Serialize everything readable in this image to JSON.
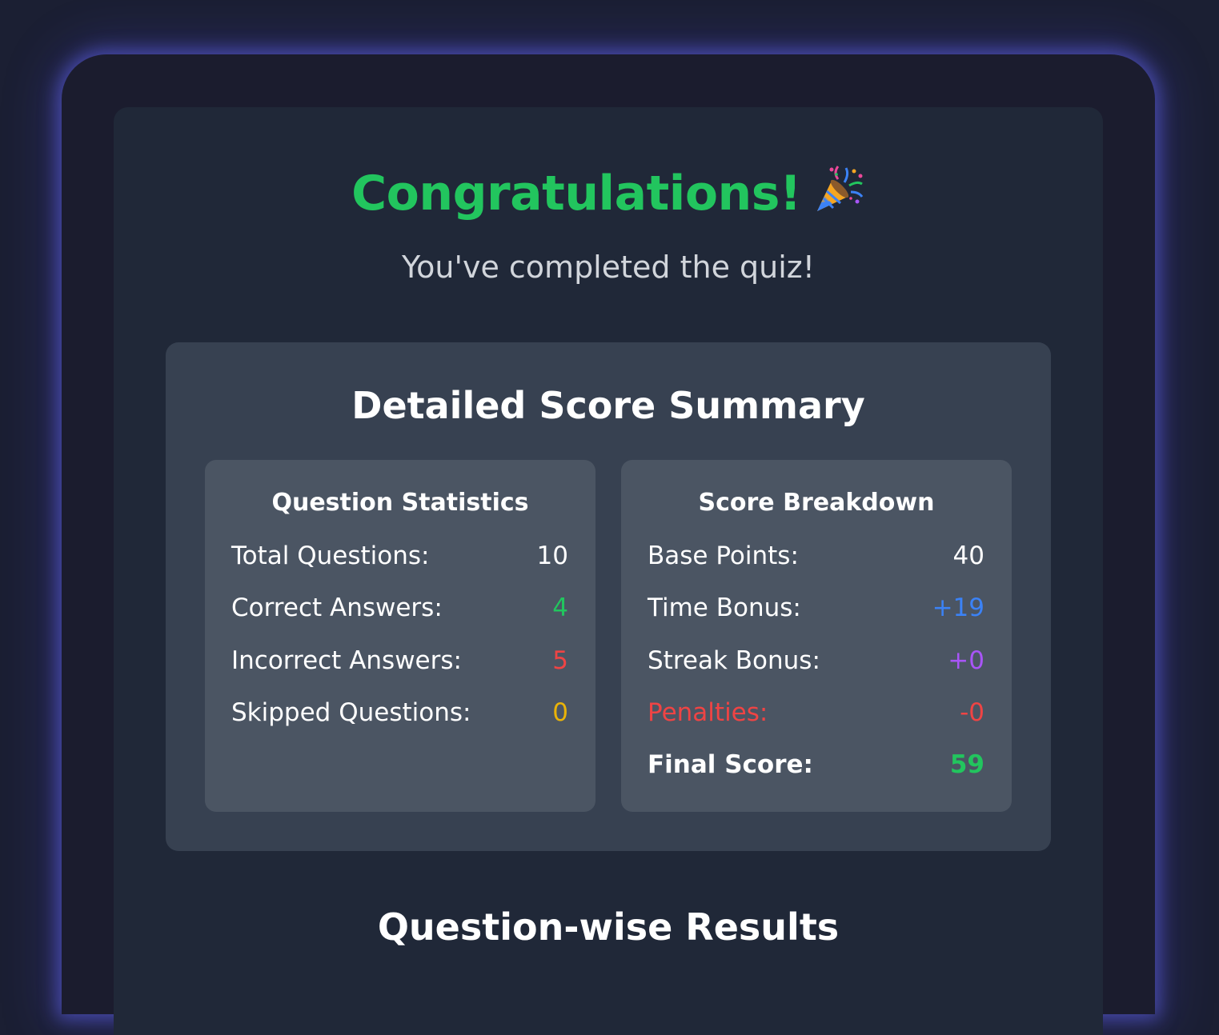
{
  "header": {
    "title": "Congratulations!",
    "title_icon": "party-popper-icon",
    "subtitle": "You've completed the quiz!"
  },
  "summary": {
    "title": "Detailed Score Summary",
    "question_statistics": {
      "title": "Question Statistics",
      "rows": [
        {
          "label": "Total Questions:",
          "value": "10"
        },
        {
          "label": "Correct Answers:",
          "value": "4"
        },
        {
          "label": "Incorrect Answers:",
          "value": "5"
        },
        {
          "label": "Skipped Questions:",
          "value": "0"
        }
      ]
    },
    "score_breakdown": {
      "title": "Score Breakdown",
      "rows": [
        {
          "label": "Base Points:",
          "value": "40"
        },
        {
          "label": "Time Bonus:",
          "value": "+19"
        },
        {
          "label": "Streak Bonus:",
          "value": "+0"
        },
        {
          "label": "Penalties:",
          "value": "-0"
        },
        {
          "label": "Final Score:",
          "value": "59"
        }
      ]
    }
  },
  "results": {
    "title": "Question-wise Results"
  },
  "colors": {
    "success": "#22c55e",
    "danger": "#ef4444",
    "warning": "#eab308",
    "info": "#3b82f6",
    "accent": "#a855f7",
    "glow": "#6366f1"
  }
}
